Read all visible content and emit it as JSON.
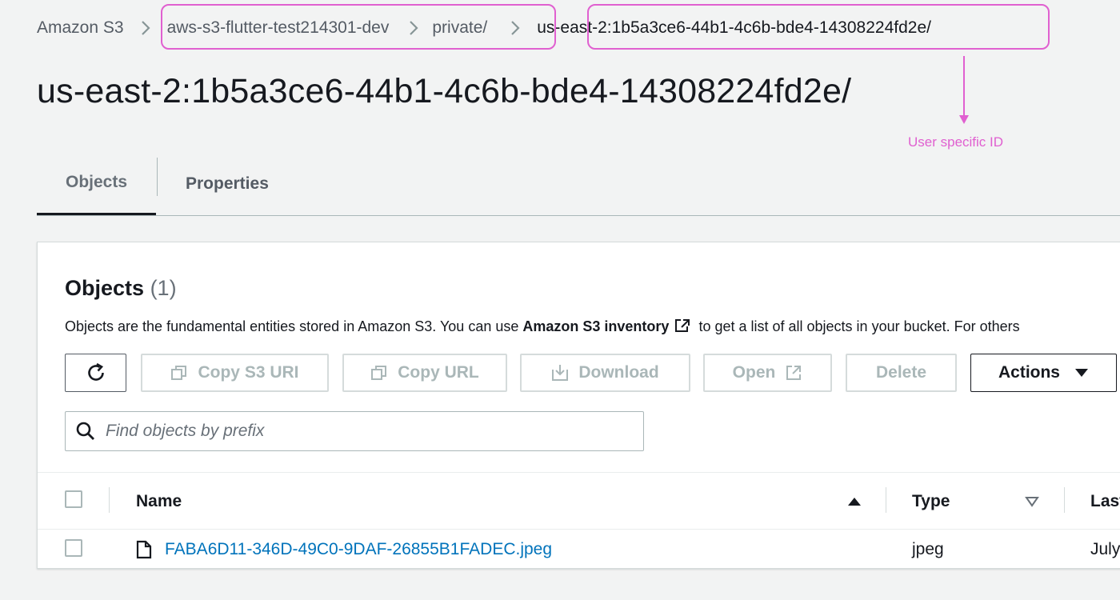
{
  "breadcrumb": {
    "items": [
      "Amazon S3",
      "aws-s3-flutter-test214301-dev",
      "private/",
      "us-east-2:1b5a3ce6-44b1-4c6b-bde4-14308224fd2e/"
    ]
  },
  "page_title": "us-east-2:1b5a3ce6-44b1-4c6b-bde4-14308224fd2e/",
  "annotation": {
    "label": "User specific ID",
    "color": "#e060d0"
  },
  "tabs": [
    {
      "label": "Objects",
      "active": true
    },
    {
      "label": "Properties",
      "active": false
    }
  ],
  "objects_panel": {
    "title": "Objects",
    "count": "(1)",
    "description_prefix": "Objects are the fundamental entities stored in Amazon S3. You can use",
    "description_link": "Amazon S3 inventory",
    "description_suffix": "to get a list of all objects in your bucket. For others"
  },
  "toolbar": {
    "refresh_icon": "refresh-icon",
    "copy_s3_uri": "Copy S3 URI",
    "copy_url": "Copy URL",
    "download": "Download",
    "open": "Open",
    "delete": "Delete",
    "actions": "Actions"
  },
  "search": {
    "placeholder": "Find objects by prefix",
    "value": ""
  },
  "table": {
    "columns": [
      "Name",
      "Type",
      "Last"
    ],
    "rows": [
      {
        "name": "FABA6D11-346D-49C0-9DAF-26855B1FADEC.jpeg",
        "type": "jpeg",
        "last_modified": "July"
      }
    ]
  },
  "colors": {
    "link": "#0073bb",
    "highlight": "#e060d0",
    "disabled_text": "#aab7b8",
    "text": "#16191f"
  }
}
